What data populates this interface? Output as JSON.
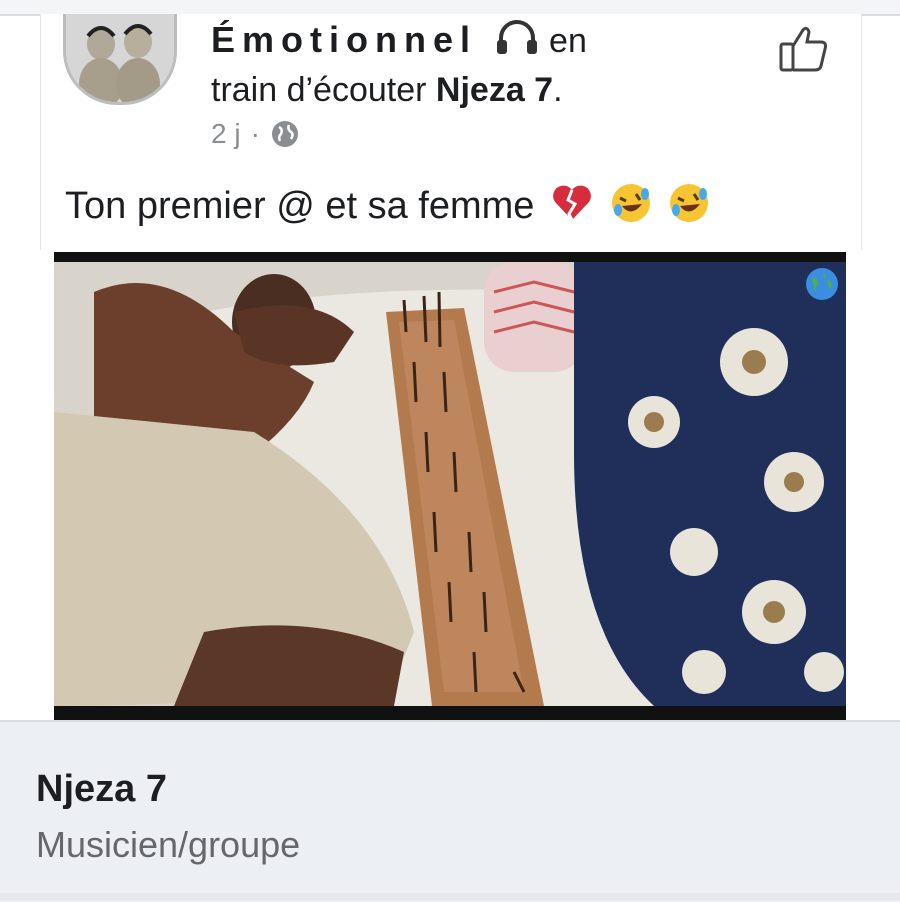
{
  "post": {
    "author_name": "Émotionnel",
    "activity_prefix": "en",
    "activity_line2_prefix": "train d’écouter",
    "activity_target": "Njeza 7",
    "activity_suffix": ".",
    "timestamp": "2 j",
    "separator": "·",
    "privacy_icon": "globe-icon",
    "activity_icon": "headphones-icon",
    "like_icon": "thumbs-up-icon",
    "text": "Ton premier @ et sa femme",
    "text_emojis": [
      "broken-heart-emoji",
      "rolling-laughing-emoji",
      "rolling-laughing-emoji"
    ]
  },
  "link_preview": {
    "title": "Njeza 7",
    "category": "Musicien/groupe"
  },
  "colors": {
    "text_primary": "#1c1e21",
    "text_secondary": "#65676b",
    "meta_gray": "#8a8d91",
    "preview_bg": "#eceff3"
  }
}
